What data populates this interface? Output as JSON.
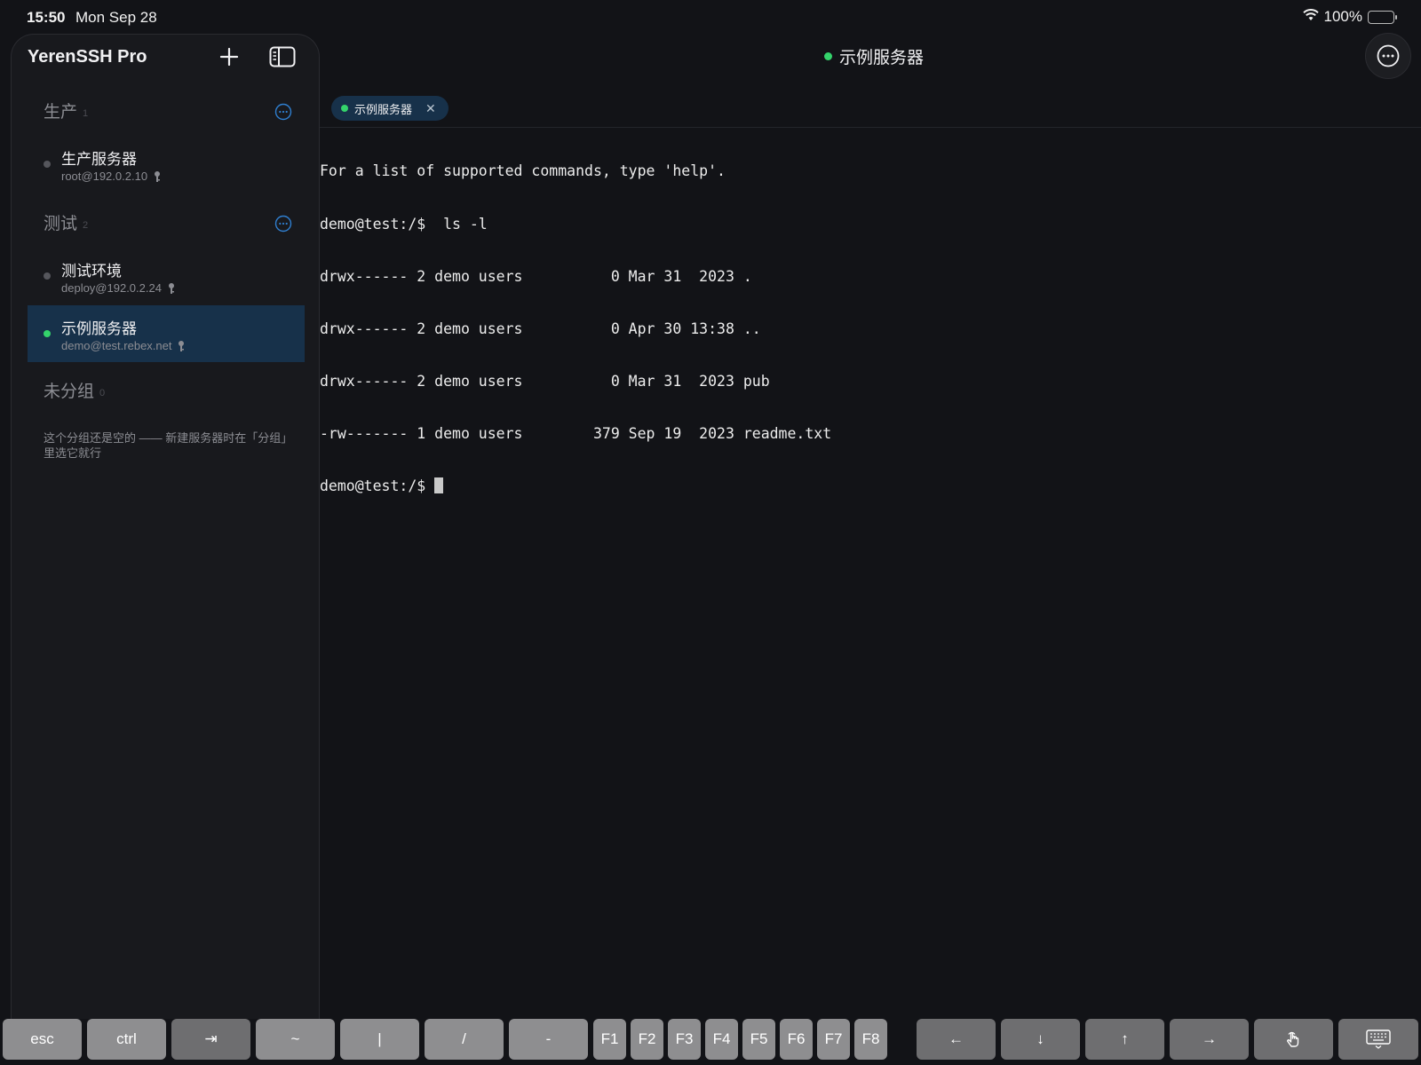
{
  "status_bar": {
    "time": "15:50",
    "date": "Mon Sep 28",
    "battery": "100%",
    "battery_level": 1.0
  },
  "sidebar": {
    "app_title": "YerenSSH Pro",
    "groups": [
      {
        "name": "生产",
        "count": "1",
        "servers": [
          {
            "name": "生产服务器",
            "address": "root@192.0.2.10",
            "online": false
          }
        ]
      },
      {
        "name": "测试",
        "count": "2",
        "servers": [
          {
            "name": "测试环境",
            "address": "deploy@192.0.2.24",
            "online": false
          },
          {
            "name": "示例服务器",
            "address": "demo@test.rebex.net",
            "online": true,
            "selected": true
          }
        ]
      },
      {
        "name": "未分组",
        "count": "0",
        "empty_note": "这个分组还是空的 —— 新建服务器时在「分组」里选它就行"
      }
    ]
  },
  "main": {
    "title": "示例服务器",
    "tabs": [
      {
        "label": "示例服务器"
      }
    ]
  },
  "terminal": {
    "lines": [
      "For a list of supported commands, type 'help'.",
      "demo@test:/$  ls -l",
      "drwx------ 2 demo users          0 Mar 31  2023 .",
      "drwx------ 2 demo users          0 Apr 30 13:38 ..",
      "drwx------ 2 demo users          0 Mar 31  2023 pub",
      "-rw------- 1 demo users        379 Sep 19  2023 readme.txt",
      "demo@test:/$ "
    ]
  },
  "keybar": {
    "keys": [
      "esc",
      "ctrl",
      "⇥",
      "~",
      "|",
      "/",
      "-",
      "F1",
      "F2",
      "F3",
      "F4",
      "F5",
      "F6",
      "F7",
      "F8",
      "←",
      "↓",
      "↑",
      "→"
    ]
  },
  "colors": {
    "accent_online": "#34d36b",
    "selected_bg": "#17314a",
    "accent_blue": "#2f7fd0"
  }
}
